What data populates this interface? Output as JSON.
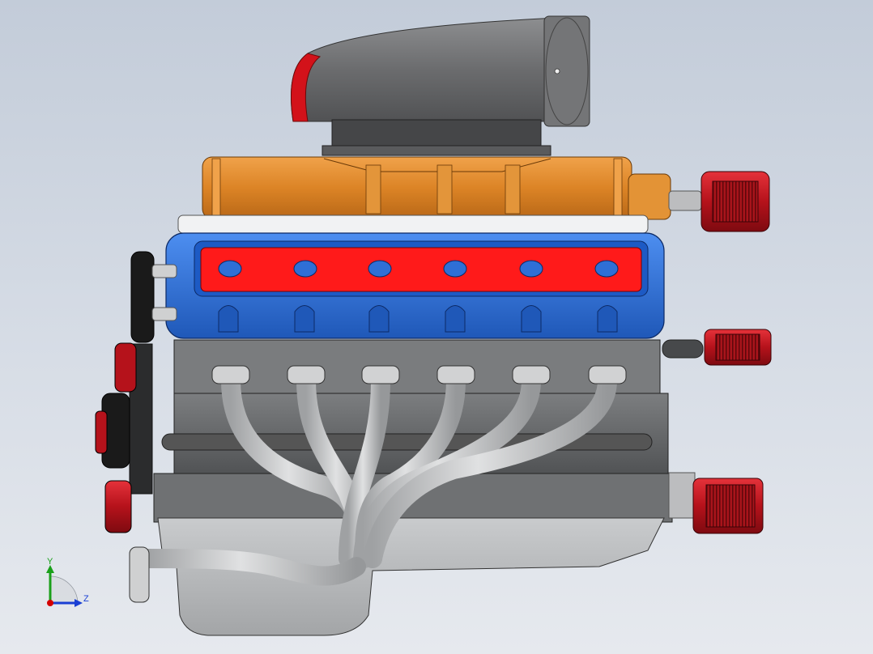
{
  "viewport": {
    "background_top": "#c3ccd9",
    "background_bottom": "#e6e9ee"
  },
  "model": {
    "colors": {
      "intake_scoop": "#6f7072",
      "scoop_lip": "#d3121a",
      "supercharger": "#e08a2c",
      "valve_cover": "#2f6fd6",
      "valve_cover_panel": "#ff1a1a",
      "block": "#6a6c6e",
      "headers": "#c4c6c8",
      "oil_pan": "#b9bbbd",
      "filters": "#b5121b",
      "pulleys": "#1a1a1a"
    },
    "icons": [
      "intake-scoop-icon",
      "supercharger-icon",
      "valve-cover-icon",
      "engine-block-icon",
      "exhaust-header-icon",
      "oil-pan-icon",
      "fuel-filter-icon",
      "pulley-icon"
    ]
  },
  "triad": {
    "axis_y_label": "Y",
    "axis_z_label": "Z",
    "colors": {
      "x": "#d40000",
      "y": "#1aa01a",
      "z": "#1a3fd4"
    }
  }
}
